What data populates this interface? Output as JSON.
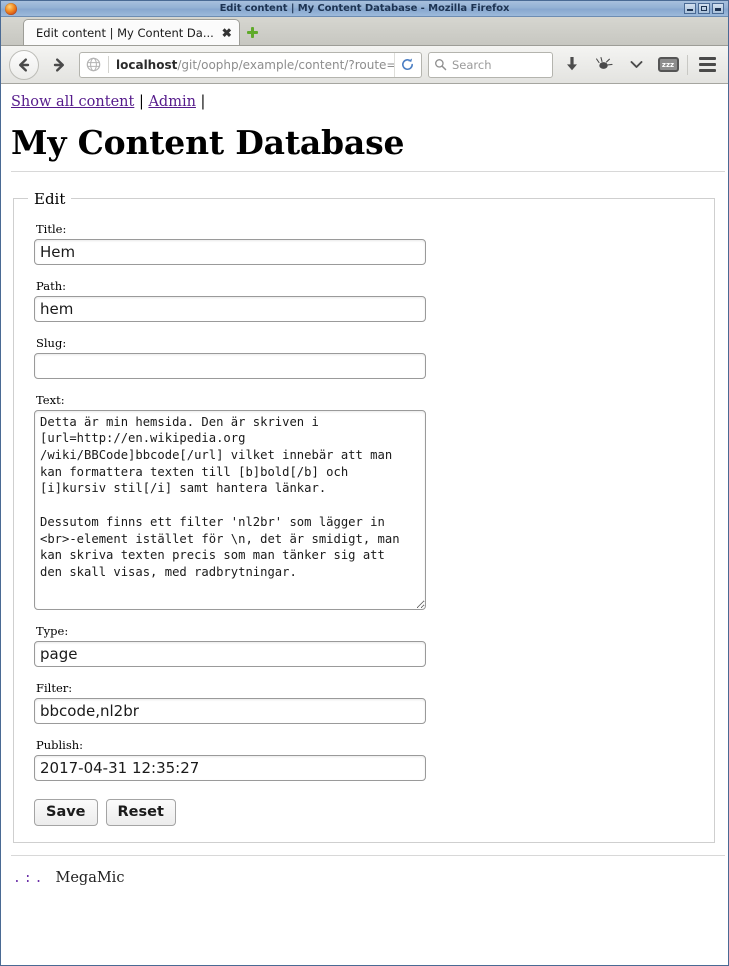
{
  "window": {
    "title": "Edit content | My Content Database - Mozilla Firefox",
    "logo_icon": "firefox-logo-icon",
    "minimize_label": "minimize-icon",
    "maximize_label": "maximize-icon",
    "close_label": "close-icon"
  },
  "tabs": {
    "items": [
      {
        "title": "Edit content | My Content Da...",
        "close_glyph": "✖"
      }
    ],
    "new_tab_icon": "plus-icon"
  },
  "toolbar": {
    "back_icon": "back-arrow-icon",
    "forward_icon": "forward-arrow-icon",
    "identity_icon": "globe-icon",
    "url_host": "localhost",
    "url_path": "/git/oophp/example/content/?route=edit&id",
    "reload_icon": "reload-icon",
    "search_placeholder": "Search",
    "search_icon": "search-icon",
    "downloads_icon": "download-arrow-icon",
    "addon_icon": "plugin-icon",
    "addon_chevron_icon": "chevron-down-icon",
    "sleep_badge_icon": "zzz-badge-icon",
    "sleep_badge_text": "zzz",
    "menu_icon": "hamburger-menu-icon"
  },
  "page": {
    "nav": {
      "links": [
        {
          "label": "Show all content"
        },
        {
          "label": "Admin"
        }
      ],
      "separator": "|"
    },
    "heading": "My Content Database",
    "fieldset_legend": "Edit",
    "fields": [
      {
        "label": "Title:",
        "value": "Hem",
        "placeholder": "",
        "type": "text"
      },
      {
        "label": "Path:",
        "value": "hem",
        "placeholder": "",
        "type": "text"
      },
      {
        "label": "Slug:",
        "value": "",
        "placeholder": "",
        "type": "text"
      },
      {
        "label": "Text:",
        "value": "Detta är min hemsida. Den är skriven i\n[url=http://en.wikipedia.org\n/wiki/BBCode]bbcode[/url] vilket innebär att man\nkan formattera texten till [b]bold[/b] och\n[i]kursiv stil[/i] samt hantera länkar.\n\nDessutom finns ett filter 'nl2br' som lägger in\n<br>-element istället för \\n, det är smidigt, man\nkan skriva texten precis som man tänker sig att\nden skall visas, med radbrytningar.",
        "placeholder": "",
        "type": "textarea"
      },
      {
        "label": "Type:",
        "value": "page",
        "placeholder": "",
        "type": "text"
      },
      {
        "label": "Filter:",
        "value": "bbcode,nl2br",
        "placeholder": "",
        "type": "text"
      },
      {
        "label": "Publish:",
        "value": "2017-04-31 12:35:27",
        "placeholder": "",
        "type": "text"
      }
    ],
    "buttons": {
      "save_label": "Save",
      "reset_label": "Reset"
    },
    "footer": {
      "dots": ".:.",
      "brand": "MegaMic"
    }
  },
  "colors": {
    "link": "#551a8b",
    "titlebar": "#93b1d4",
    "accent_green": "#5faa2a",
    "border": "#cfcfcf"
  }
}
